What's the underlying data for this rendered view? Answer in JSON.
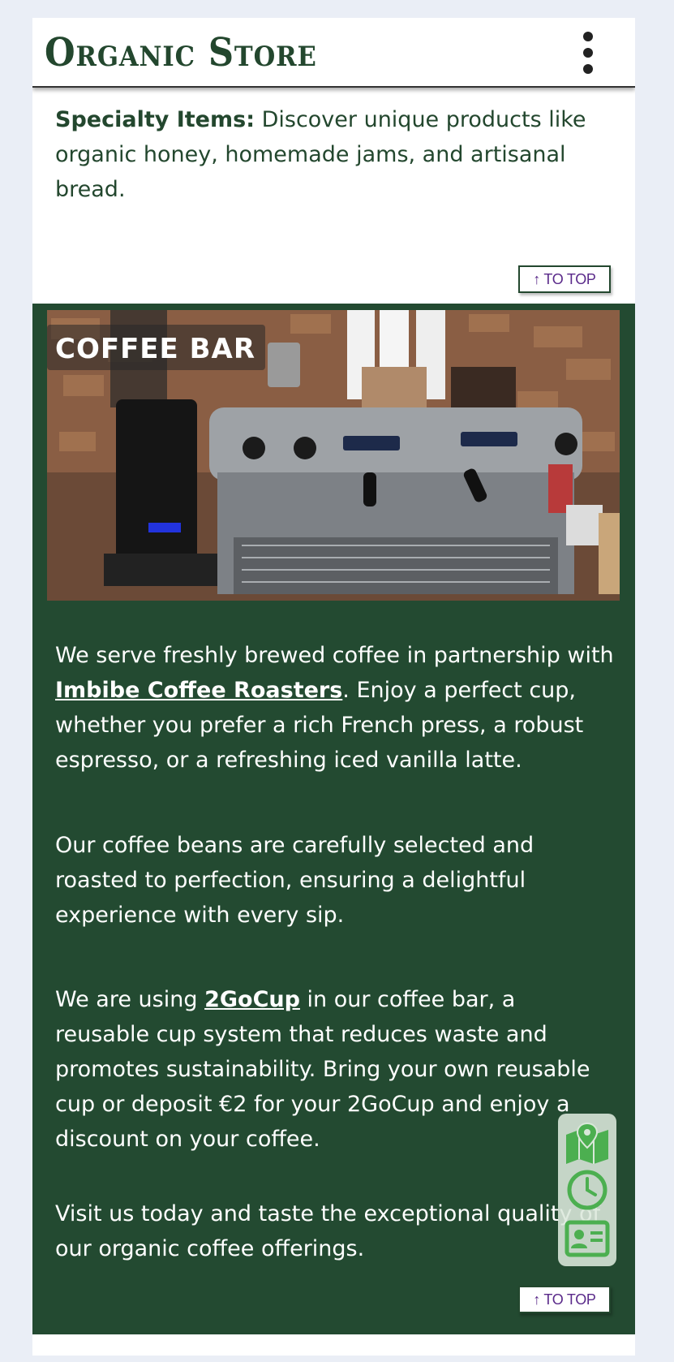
{
  "header": {
    "logo_text": "Organic Store",
    "menu_icon": "vertical-dots-icon"
  },
  "specialty": {
    "label": "Specialty Items:",
    "text": " Discover unique products like organic honey, homemade jams, and artisanal bread."
  },
  "to_top_label": "↑ TO TOP",
  "coffee_bar": {
    "title": "COFFEE BAR",
    "image_subject": "espresso-machine-photo",
    "p1_before": "We serve freshly brewed coffee in partnership with ",
    "p1_link": "Imbibe Coffee Roasters",
    "p1_after": ". Enjoy a perfect cup, whether you prefer a rich French press, a robust espresso, or a refreshing iced vanilla latte.",
    "p2": "Our coffee beans are carefully selected and roasted to perfection, ensuring a delightful experience with every sip.",
    "p3_before": "We are using ",
    "p3_link": "2GoCup",
    "p3_after": " in our coffee bar, a reusable cup system that reduces waste and promotes sustainability. Bring your own reusable cup or deposit €2 for your 2GoCup and enjoy a discount on your coffee.",
    "p4": "Visit us today and taste the exceptional quality of our organic coffee offerings."
  },
  "floating_actions": [
    "map-icon",
    "clock-icon",
    "contact-card-icon"
  ],
  "colors": {
    "brand_green": "#23472e",
    "accent_green": "#4caf50",
    "to_top_text": "#5a2a8a"
  }
}
